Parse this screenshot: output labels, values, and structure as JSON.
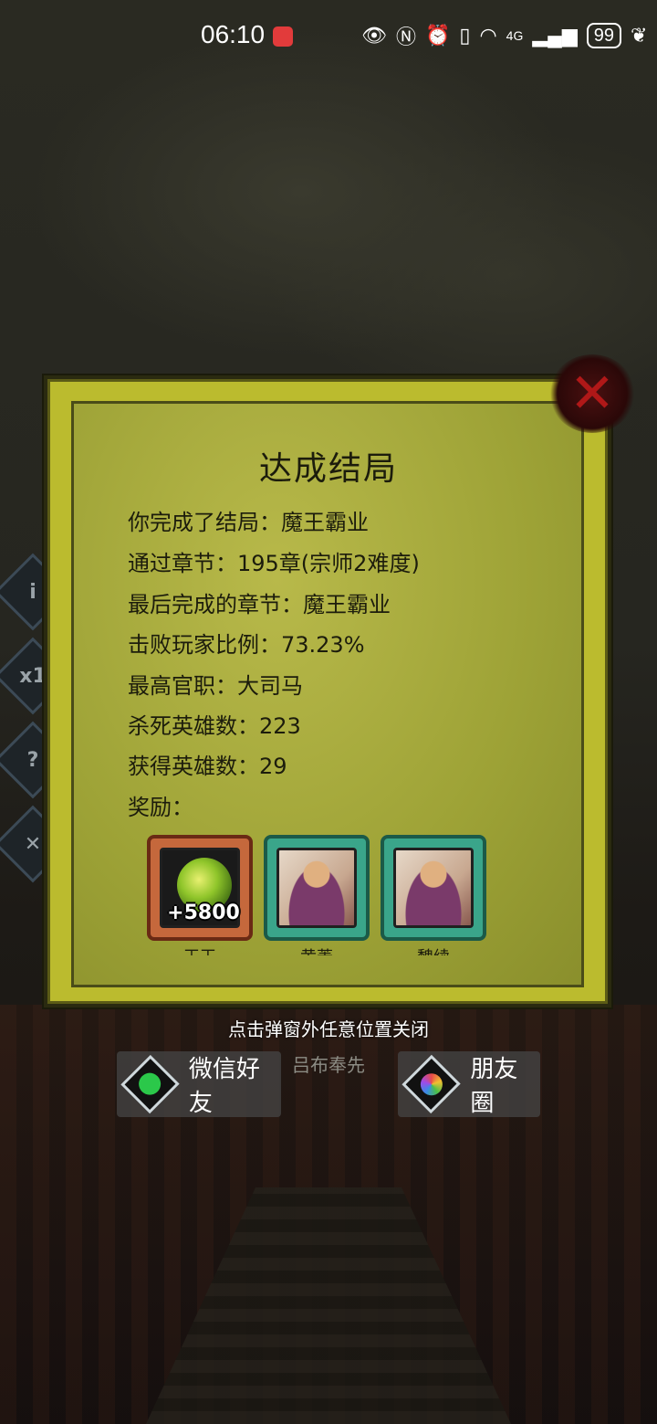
{
  "status_bar": {
    "time": "06:10",
    "battery": "99",
    "network": "4G"
  },
  "dialog": {
    "title": "达成结局",
    "lines": [
      "你完成了结局：魔王霸业",
      "通过章节：195章(宗师2难度)",
      "最后完成的章节：魔王霸业",
      "击败玩家比例：73.23%",
      "最高官职：大司马",
      "杀死英雄数：223",
      "获得英雄数：29",
      "奖励："
    ],
    "rewards": [
      {
        "type": "orb",
        "count": "+5800",
        "name": "王玉"
      },
      {
        "type": "hero",
        "count": "",
        "name": "黄蓋"
      },
      {
        "type": "hero",
        "count": "",
        "name": "魏续"
      }
    ]
  },
  "hint": "点击弹窗外任意位置关闭",
  "background_label": "吕布奉先",
  "share": {
    "wechat_friends": "微信好友",
    "moments": "朋友圈"
  },
  "colors": {
    "dialog_frame": "#bbbb2e",
    "close": "#b01818",
    "reward_bronze": "#c5683c",
    "reward_jade": "#3aa58a"
  }
}
